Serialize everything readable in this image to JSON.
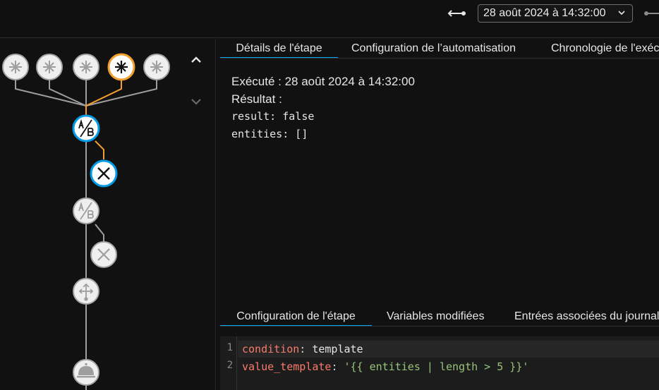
{
  "header": {
    "selected_run": "28 août 2024 à 14:32:00",
    "prev_icon": "arrow-left-icon",
    "next_icon": "arrow-right-icon"
  },
  "graph": {
    "nav_up_icon": "chevron-up-icon",
    "nav_down_icon": "chevron-down-icon",
    "accent_color": "#f29f2e",
    "active_color": "#039be5",
    "inactive_color": "#9e9e9e"
  },
  "tabs": [
    {
      "label": "Détails de l'étape",
      "active": true
    },
    {
      "label": "Configuration de l’automatisation",
      "active": false
    },
    {
      "label": "Chronologie de l'exécution",
      "active": false
    }
  ],
  "details": {
    "executed_label": "Exécuté : 28 août 2024 à 14:32:00",
    "result_label": "Résultat :",
    "result_line1": "result: false",
    "result_line2": "entities: []"
  },
  "bottom_tabs": [
    {
      "label": "Configuration de l'étape",
      "active": true
    },
    {
      "label": "Variables modifiées",
      "active": false
    },
    {
      "label": "Entrées associées du journal",
      "active": false
    }
  ],
  "editor": {
    "lines": [
      {
        "number": "1",
        "key": "condition",
        "sep": ": ",
        "value": "template"
      },
      {
        "number": "2",
        "key": "value_template",
        "sep": ": ",
        "value": "'{{ entities | length > 5 }}'"
      }
    ]
  }
}
